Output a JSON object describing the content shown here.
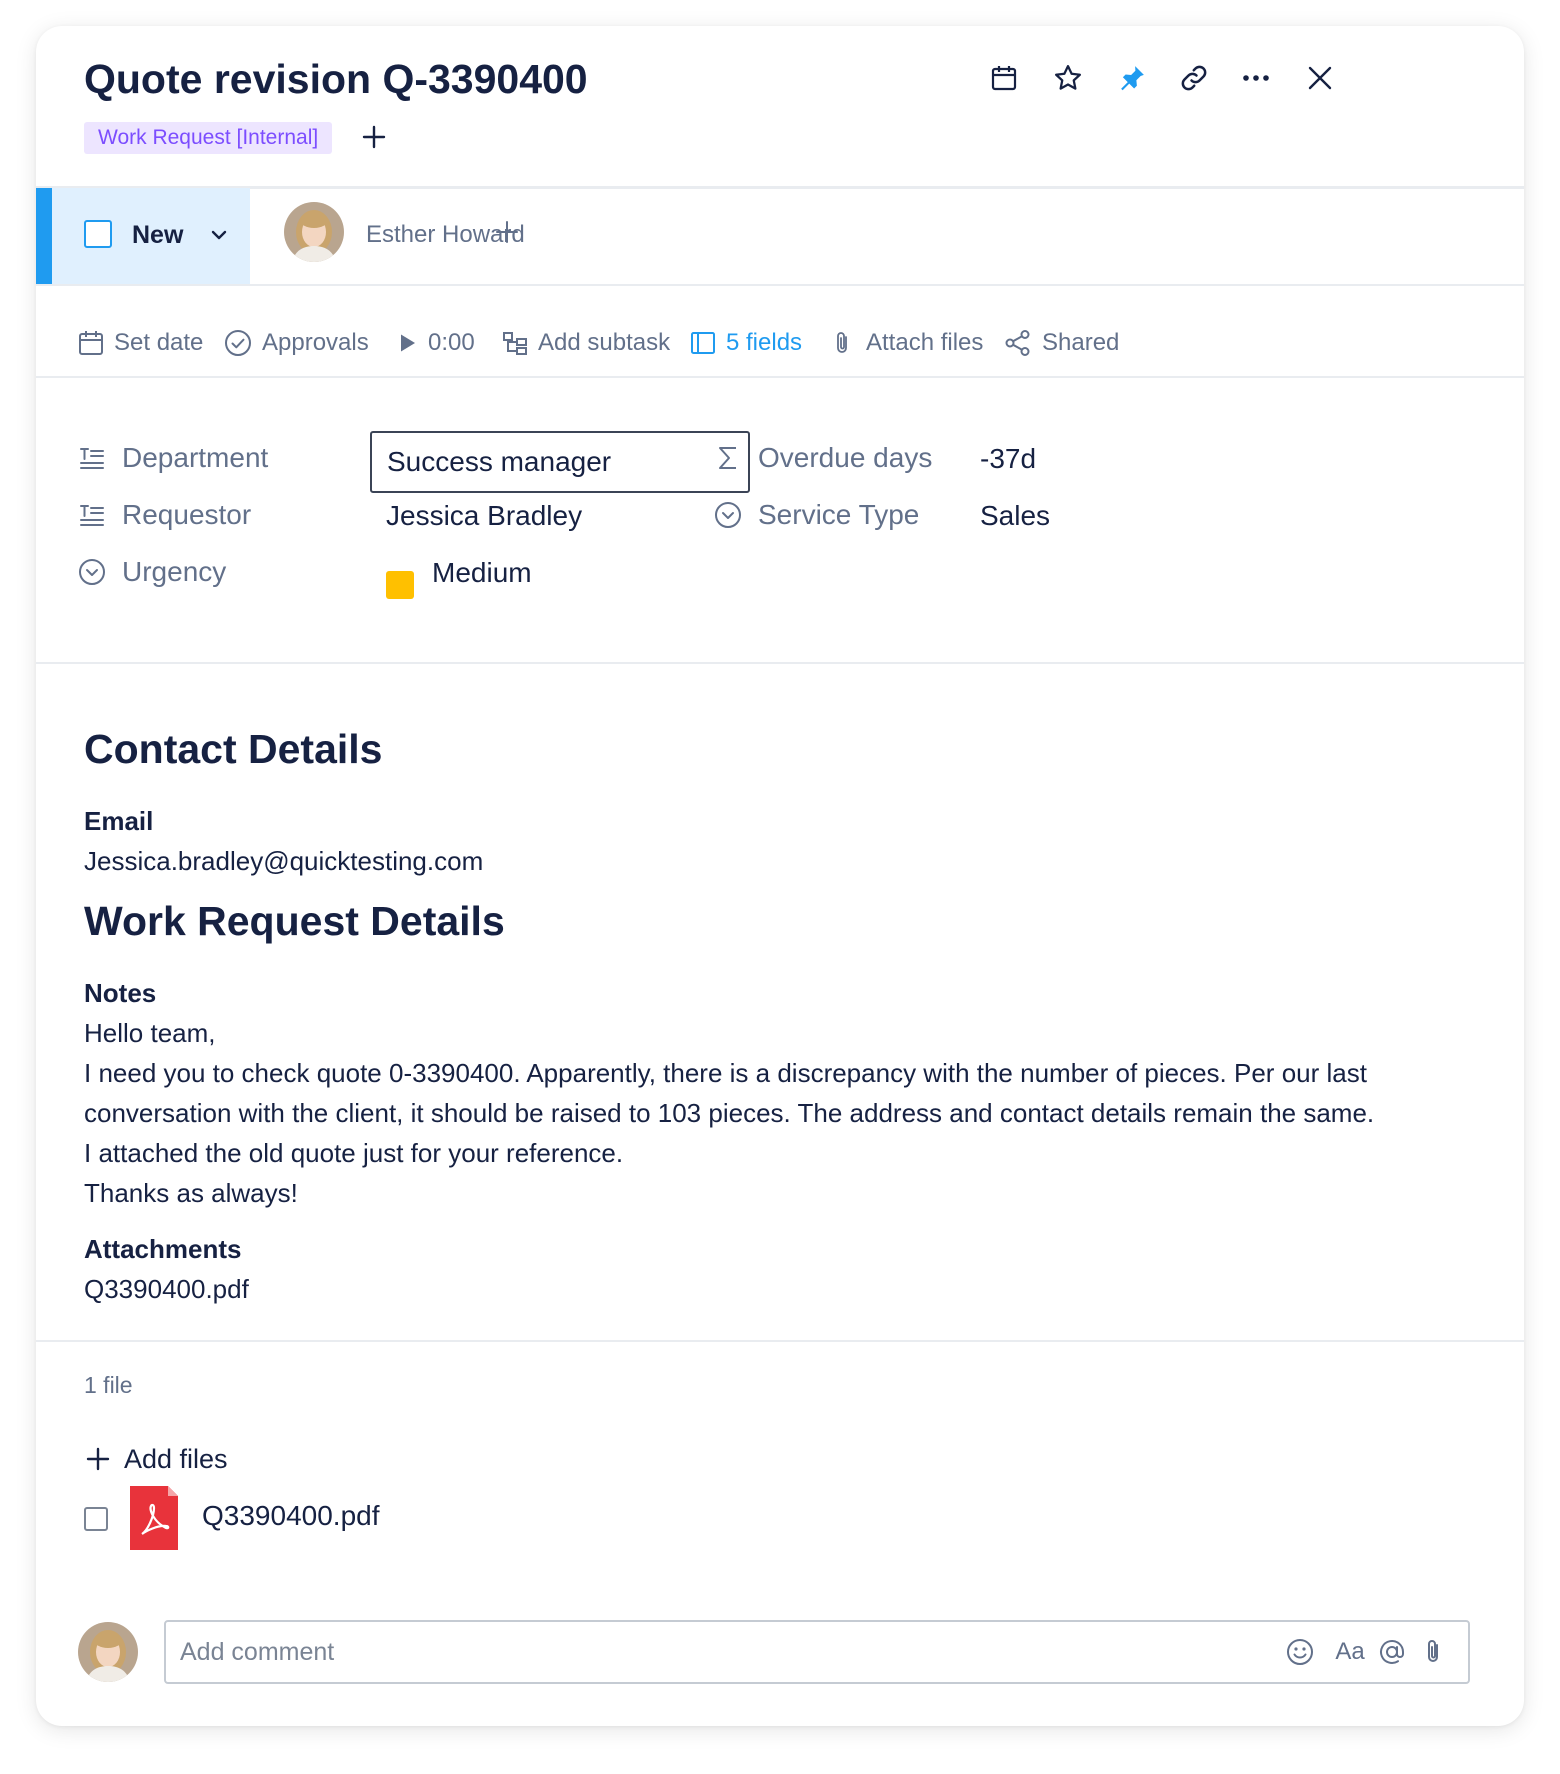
{
  "header": {
    "title": "Quote revision Q-3390400",
    "tag": "Work Request [Internal]",
    "icons": [
      "calendar-icon",
      "star-icon",
      "pin-icon",
      "link-icon",
      "more-icon",
      "close-icon"
    ]
  },
  "status": {
    "label": "New",
    "accent_color": "#1f9bf0"
  },
  "assignee": {
    "name": "Esther Howard"
  },
  "toolbar": {
    "set_date": "Set date",
    "approvals": "Approvals",
    "timer": "0:00",
    "add_subtask": "Add subtask",
    "fields": "5 fields",
    "attach_files": "Attach files",
    "shared": "Shared"
  },
  "fields": {
    "department": {
      "label": "Department",
      "value": "Success manager"
    },
    "requestor": {
      "label": "Requestor",
      "value": "Jessica Bradley"
    },
    "urgency": {
      "label": "Urgency",
      "value": "Medium",
      "color": "#ffc000"
    },
    "overdue_days": {
      "label": "Overdue days",
      "value": "-37d"
    },
    "service_type": {
      "label": "Service Type",
      "value": "Sales"
    }
  },
  "contact": {
    "heading": "Contact Details",
    "email_label": "Email",
    "email_value": "Jessica.bradley@quicktesting.com"
  },
  "work_request": {
    "heading": "Work Request Details",
    "notes_label": "Notes",
    "notes_lines": [
      "Hello team,",
      "I need you to check quote 0-3390400. Apparently, there is a discrepancy with the number of pieces. Per our last",
      "conversation with the client, it should be raised to 103 pieces. The address and contact details remain the same.",
      "I attached the old quote just for your reference.",
      "Thanks as always!"
    ],
    "attachments_label": "Attachments",
    "attachments_value": "Q3390400.pdf"
  },
  "files": {
    "count": "1 file",
    "add_label": "Add files",
    "items": [
      {
        "name": "Q3390400.pdf",
        "icon": "pdf-icon"
      }
    ]
  },
  "comment": {
    "placeholder": "Add comment",
    "format_label": "Aa",
    "icons": [
      "emoji-icon",
      "format-icon",
      "mention-icon",
      "attach-icon"
    ]
  }
}
